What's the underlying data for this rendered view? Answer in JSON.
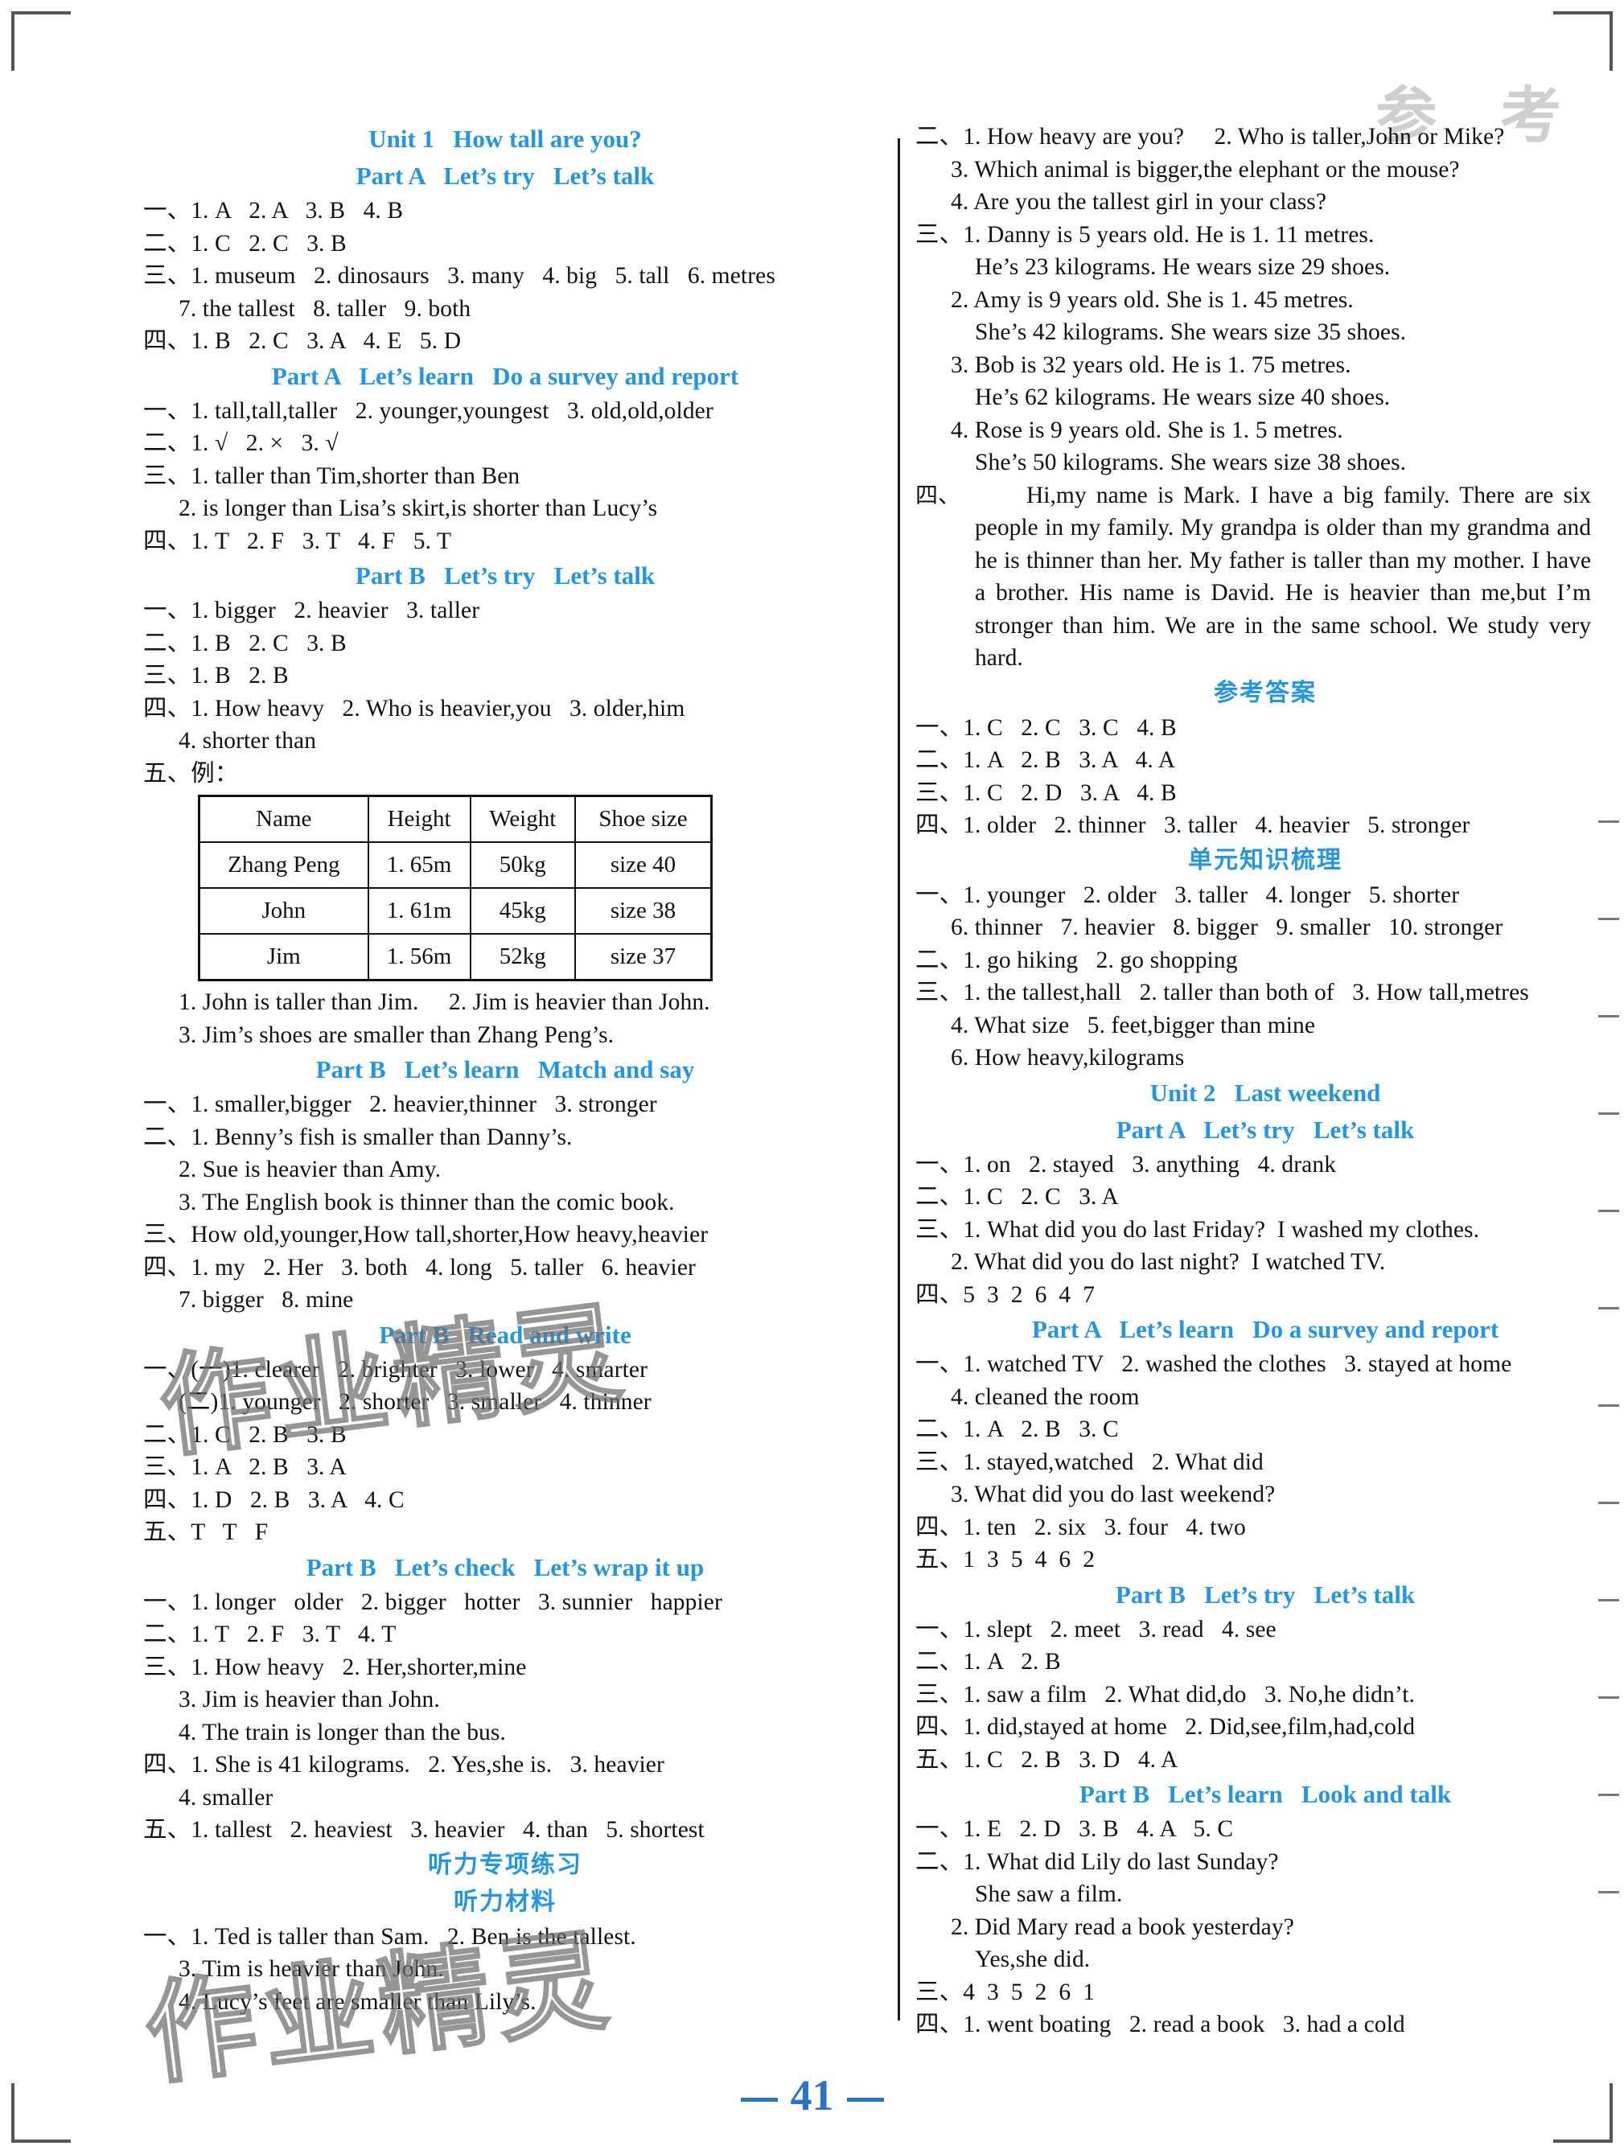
{
  "page": {
    "banner": "参  考",
    "number": "41"
  },
  "left_column": [
    {
      "type": "section",
      "text": "Unit 1   How tall are you?"
    },
    {
      "type": "section",
      "text": "Part A   Let’s try   Let’s talk"
    },
    {
      "type": "line",
      "text": "一、1. A   2. A   3. B   4. B"
    },
    {
      "type": "line",
      "text": "二、1. C   2. C   3. B"
    },
    {
      "type": "line",
      "text": "三、1. museum   2. dinosaurs   3. many   4. big   5. tall   6. metres"
    },
    {
      "type": "line",
      "indent": 1,
      "text": "7. the tallest   8. taller   9. both"
    },
    {
      "type": "line",
      "text": "四、1. B   2. C   3. A   4. E   5. D"
    },
    {
      "type": "section",
      "text": "Part A   Let’s learn   Do a survey and report"
    },
    {
      "type": "line",
      "text": "一、1. tall,tall,taller   2. younger,youngest   3. old,old,older"
    },
    {
      "type": "line",
      "text": "二、1. √   2. ×   3. √"
    },
    {
      "type": "line",
      "text": "三、1. taller than Tim,shorter than Ben"
    },
    {
      "type": "line",
      "indent": 1,
      "text": "2. is longer than Lisa’s skirt,is shorter than Lucy’s"
    },
    {
      "type": "line",
      "text": "四、1. T   2. F   3. T   4. F   5. T"
    },
    {
      "type": "section",
      "text": "Part B   Let’s try   Let’s talk"
    },
    {
      "type": "line",
      "text": "一、1. bigger   2. heavier   3. taller"
    },
    {
      "type": "line",
      "text": "二、1. B   2. C   3. B"
    },
    {
      "type": "line",
      "text": "三、1. B   2. B"
    },
    {
      "type": "line",
      "text": "四、1. How heavy   2. Who is heavier,you   3. older,him"
    },
    {
      "type": "line",
      "indent": 1,
      "text": "4. shorter than"
    },
    {
      "type": "line",
      "text": "五、例："
    },
    {
      "type": "table"
    },
    {
      "type": "line",
      "indent": 1,
      "text": "1. John is taller than Jim.     2. Jim is heavier than John."
    },
    {
      "type": "line",
      "indent": 1,
      "text": "3. Jim’s shoes are smaller than Zhang Peng’s."
    },
    {
      "type": "section",
      "text": "Part B   Let’s learn   Match and say"
    },
    {
      "type": "line",
      "text": "一、1. smaller,bigger   2. heavier,thinner   3. stronger"
    },
    {
      "type": "line",
      "text": "二、1. Benny’s fish is smaller than Danny’s."
    },
    {
      "type": "line",
      "indent": 1,
      "text": "2. Sue is heavier than Amy."
    },
    {
      "type": "line",
      "indent": 1,
      "text": "3. The English book is thinner than the comic book."
    },
    {
      "type": "line",
      "text": "三、How old,younger,How tall,shorter,How heavy,heavier"
    },
    {
      "type": "line",
      "text": "四、1. my   2. Her   3. both   4. long   5. taller   6. heavier"
    },
    {
      "type": "line",
      "indent": 1,
      "text": "7. bigger   8. mine"
    },
    {
      "type": "section",
      "text": "Part B   Read and write"
    },
    {
      "type": "line",
      "text": "一、(一)1. clearer   2. brighter   3. lower   4. smarter"
    },
    {
      "type": "line",
      "indent": 1,
      "text": "(二)1. younger   2. shorter   3. smaller   4. thinner"
    },
    {
      "type": "line",
      "text": "二、1. C   2. B   3. B"
    },
    {
      "type": "line",
      "text": "三、1. A   2. B   3. A"
    },
    {
      "type": "line",
      "text": "四、1. D   2. B   3. A   4. C"
    },
    {
      "type": "line",
      "text": "五、T   T   F"
    },
    {
      "type": "section",
      "text": "Part B   Let’s check   Let’s wrap it up"
    },
    {
      "type": "line",
      "text": "一、1. longer   older   2. bigger   hotter   3. sunnier   happier"
    },
    {
      "type": "line",
      "text": "二、1. T   2. F   3. T   4. T"
    },
    {
      "type": "line",
      "text": "三、1. How heavy   2. Her,shorter,mine"
    },
    {
      "type": "line",
      "indent": 1,
      "text": "3. Jim is heavier than John."
    },
    {
      "type": "line",
      "indent": 1,
      "text": "4. The train is longer than the bus."
    },
    {
      "type": "line",
      "text": "四、1. She is 41 kilograms.   2. Yes,she is.   3. heavier"
    },
    {
      "type": "line",
      "indent": 1,
      "text": "4. smaller"
    },
    {
      "type": "line",
      "text": "五、1. tallest   2. heaviest   3. heavier   4. than   5. shortest"
    },
    {
      "type": "section",
      "cn": true,
      "text": "听力专项练习"
    },
    {
      "type": "section",
      "cn": true,
      "text": "听力材料"
    },
    {
      "type": "line",
      "text": "一、1. Ted is taller than Sam.   2. Ben is the tallest."
    },
    {
      "type": "line",
      "indent": 1,
      "text": "3. Tim is heavier than John."
    },
    {
      "type": "line",
      "indent": 1,
      "text": "4. Lucy’s feet are smaller than Lily’s."
    }
  ],
  "table": {
    "headers": [
      "Name",
      "Height",
      "Weight",
      "Shoe size"
    ],
    "rows": [
      [
        "Zhang Peng",
        "1. 65m",
        "50kg",
        "size 40"
      ],
      [
        "John",
        "1. 61m",
        "45kg",
        "size 38"
      ],
      [
        "Jim",
        "1. 56m",
        "52kg",
        "size 37"
      ]
    ]
  },
  "right_column": [
    {
      "type": "line",
      "text": "二、1. How heavy are you?     2. Who is taller,John or Mike?"
    },
    {
      "type": "line",
      "indent": 1,
      "text": "3. Which animal is bigger,the elephant or the mouse?"
    },
    {
      "type": "line",
      "indent": 1,
      "text": "4. Are you the tallest girl in your class?"
    },
    {
      "type": "line",
      "text": "三、1. Danny is 5 years old. He is 1. 11 metres."
    },
    {
      "type": "line",
      "indent": 2,
      "text": "He’s 23 kilograms. He wears size 29 shoes."
    },
    {
      "type": "line",
      "indent": 1,
      "text": "2. Amy is 9 years old. She is 1. 45 metres."
    },
    {
      "type": "line",
      "indent": 2,
      "text": "She’s 42 kilograms. She wears size 35 shoes."
    },
    {
      "type": "line",
      "indent": 1,
      "text": "3. Bob is 32 years old. He is 1. 75 metres."
    },
    {
      "type": "line",
      "indent": 2,
      "text": "He’s 62 kilograms. He wears size 40 shoes."
    },
    {
      "type": "line",
      "indent": 1,
      "text": "4. Rose is 9 years old. She is 1. 5 metres."
    },
    {
      "type": "line",
      "indent": 2,
      "text": "She’s 50 kilograms. She wears size 38 shoes."
    },
    {
      "type": "para",
      "mark": "四、",
      "text": "Hi,my name is Mark. I have a big family. There are six people in my family. My grandpa is older than my grandma and he is thinner than her. My father is taller than my mother. I have a brother. His name is David. He is heavier than me,but I’m stronger than him. We are in the same school. We study very hard."
    },
    {
      "type": "section",
      "cn": true,
      "text": "参考答案"
    },
    {
      "type": "line",
      "text": "一、1. C   2. C   3. C   4. B"
    },
    {
      "type": "line",
      "text": "二、1. A   2. B   3. A   4. A"
    },
    {
      "type": "line",
      "text": "三、1. C   2. D   3. A   4. B"
    },
    {
      "type": "line",
      "text": "四、1. older   2. thinner   3. taller   4. heavier   5. stronger"
    },
    {
      "type": "section",
      "cn": true,
      "text": "单元知识梳理"
    },
    {
      "type": "line",
      "text": "一、1. younger   2. older   3. taller   4. longer   5. shorter"
    },
    {
      "type": "line",
      "indent": 1,
      "text": "6. thinner   7. heavier   8. bigger   9. smaller   10. stronger"
    },
    {
      "type": "line",
      "text": "二、1. go hiking   2. go shopping"
    },
    {
      "type": "line",
      "text": "三、1. the tallest,hall   2. taller than both of   3. How tall,metres"
    },
    {
      "type": "line",
      "indent": 1,
      "text": "4. What size   5. feet,bigger than mine"
    },
    {
      "type": "line",
      "indent": 1,
      "text": "6. How heavy,kilograms"
    },
    {
      "type": "section",
      "text": "Unit 2   Last weekend"
    },
    {
      "type": "section",
      "text": "Part A   Let’s try   Let’s talk"
    },
    {
      "type": "line",
      "text": "一、1. on   2. stayed   3. anything   4. drank"
    },
    {
      "type": "line",
      "text": "二、1. C   2. C   3. A"
    },
    {
      "type": "line",
      "text": "三、1. What did you do last Friday?  I washed my clothes."
    },
    {
      "type": "line",
      "indent": 1,
      "text": "2. What did you do last night?  I watched TV."
    },
    {
      "type": "line",
      "text": "四、5  3  2  6  4  7"
    },
    {
      "type": "section",
      "text": "Part A   Let’s learn   Do a survey and report"
    },
    {
      "type": "line",
      "text": "一、1. watched TV   2. washed the clothes   3. stayed at home"
    },
    {
      "type": "line",
      "indent": 1,
      "text": "4. cleaned the room"
    },
    {
      "type": "line",
      "text": "二、1. A   2. B   3. C"
    },
    {
      "type": "line",
      "text": "三、1. stayed,watched   2. What did"
    },
    {
      "type": "line",
      "indent": 1,
      "text": "3. What did you do last weekend?"
    },
    {
      "type": "line",
      "text": "四、1. ten   2. six   3. four   4. two"
    },
    {
      "type": "line",
      "text": "五、1  3  5  4  6  2"
    },
    {
      "type": "section",
      "text": "Part B   Let’s try   Let’s talk"
    },
    {
      "type": "line",
      "text": "一、1. slept   2. meet   3. read   4. see"
    },
    {
      "type": "line",
      "text": "二、1. A   2. B"
    },
    {
      "type": "line",
      "text": "三、1. saw a film   2. What did,do   3. No,he didn’t."
    },
    {
      "type": "line",
      "text": "四、1. did,stayed at home   2. Did,see,film,had,cold"
    },
    {
      "type": "line",
      "text": "五、1. C   2. B   3. D   4. A"
    },
    {
      "type": "section",
      "text": "Part B   Let’s learn   Look and talk"
    },
    {
      "type": "line",
      "text": "一、1. E   2. D   3. B   4. A   5. C"
    },
    {
      "type": "line",
      "text": "二、1. What did Lily do last Sunday?"
    },
    {
      "type": "line",
      "indent": 2,
      "text": "She saw a film."
    },
    {
      "type": "line",
      "indent": 1,
      "text": "2. Did Mary read a book yesterday?"
    },
    {
      "type": "line",
      "indent": 2,
      "text": "Yes,she did."
    },
    {
      "type": "line",
      "text": "三、4  3  5  2  6  1"
    },
    {
      "type": "line",
      "text": "四、1. went boating   2. read a book   3. had a cold"
    }
  ],
  "watermark": {
    "text1": "作业精灵",
    "text2": "作业精灵"
  },
  "colors": {
    "heading_blue": "#2196e8",
    "page_blue": "#2a74c8",
    "body_black": "#111111"
  }
}
